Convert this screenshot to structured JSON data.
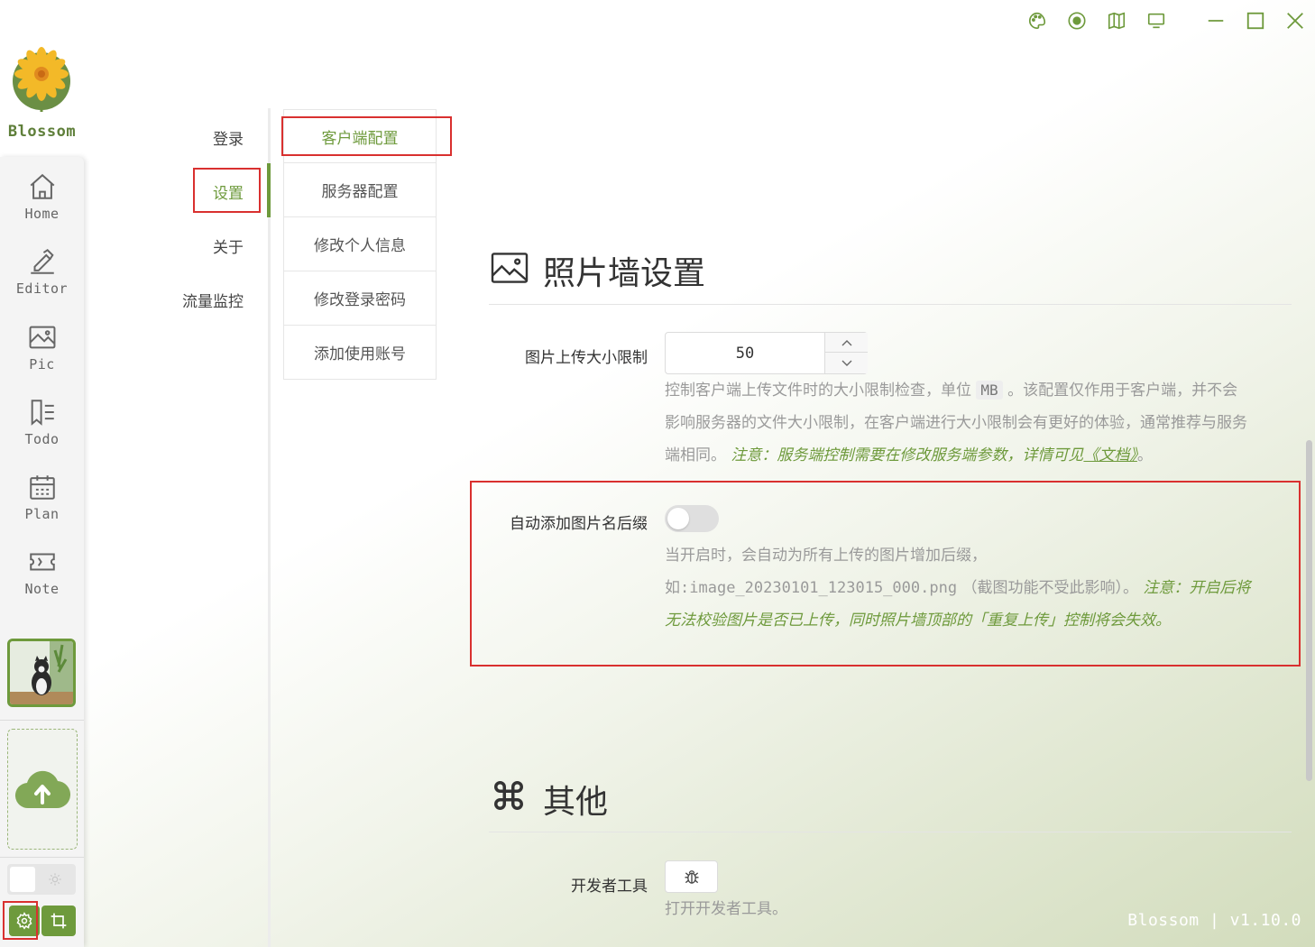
{
  "app": {
    "name": "Blossom",
    "version_text": "Blossom | v1.10.0"
  },
  "window_controls": [
    "palette-icon",
    "record-icon",
    "columns-icon",
    "monitor-icon",
    "minimize-icon",
    "maximize-icon",
    "close-icon"
  ],
  "nav": [
    {
      "label": "Home",
      "icon": "home-icon"
    },
    {
      "label": "Editor",
      "icon": "editor-icon"
    },
    {
      "label": "Pic",
      "icon": "picture-icon"
    },
    {
      "label": "Todo",
      "icon": "todo-icon"
    },
    {
      "label": "Plan",
      "icon": "calendar-icon"
    },
    {
      "label": "Note",
      "icon": "ticket-icon"
    }
  ],
  "menu": {
    "login": "登录",
    "settings": "设置",
    "about": "关于",
    "traffic": "流量监控"
  },
  "submenu": {
    "client": "客户端配置",
    "server": "服务器配置",
    "profile": "修改个人信息",
    "password": "修改登录密码",
    "account": "添加使用账号"
  },
  "photo_wall": {
    "title": "照片墙设置",
    "upload_limit": {
      "label": "图片上传大小限制",
      "value": "50",
      "desc_1": "控制客户端上传文件时的大小限制检查，单位",
      "unit": "MB",
      "desc_2": "。该配置仅作用于客户端，并不会",
      "desc_3": "影响服务器的文件大小限制，在客户端进行大小限制会有更好的体验，通常推荐与服务",
      "desc_4": "端相同。",
      "note": "注意：服务端控制需要在修改服务端参数，详情可见",
      "link": "《文档》",
      "end": "。"
    },
    "auto_suffix": {
      "label": "自动添加图片名后缀",
      "enabled": false,
      "desc_1": "当开启时，会自动为所有上传的图片增加后缀，",
      "example_prefix": "如:",
      "example": "image_20230101_123015_000.png",
      "desc_2": "（截图功能不受此影响）。",
      "note_1": "注意：开启后将",
      "note_2": "无法校验图片是否已上传，同时照片墙顶部的「重复上传」控制将会失效。"
    }
  },
  "other": {
    "title": "其他",
    "devtools": {
      "label": "开发者工具",
      "desc": "打开开发者工具。",
      "icon": "bug-icon"
    }
  },
  "colors": {
    "accent": "#6e9a3c",
    "highlight_box": "#d9302f",
    "sidebar_bg": "#f4f4f4"
  }
}
